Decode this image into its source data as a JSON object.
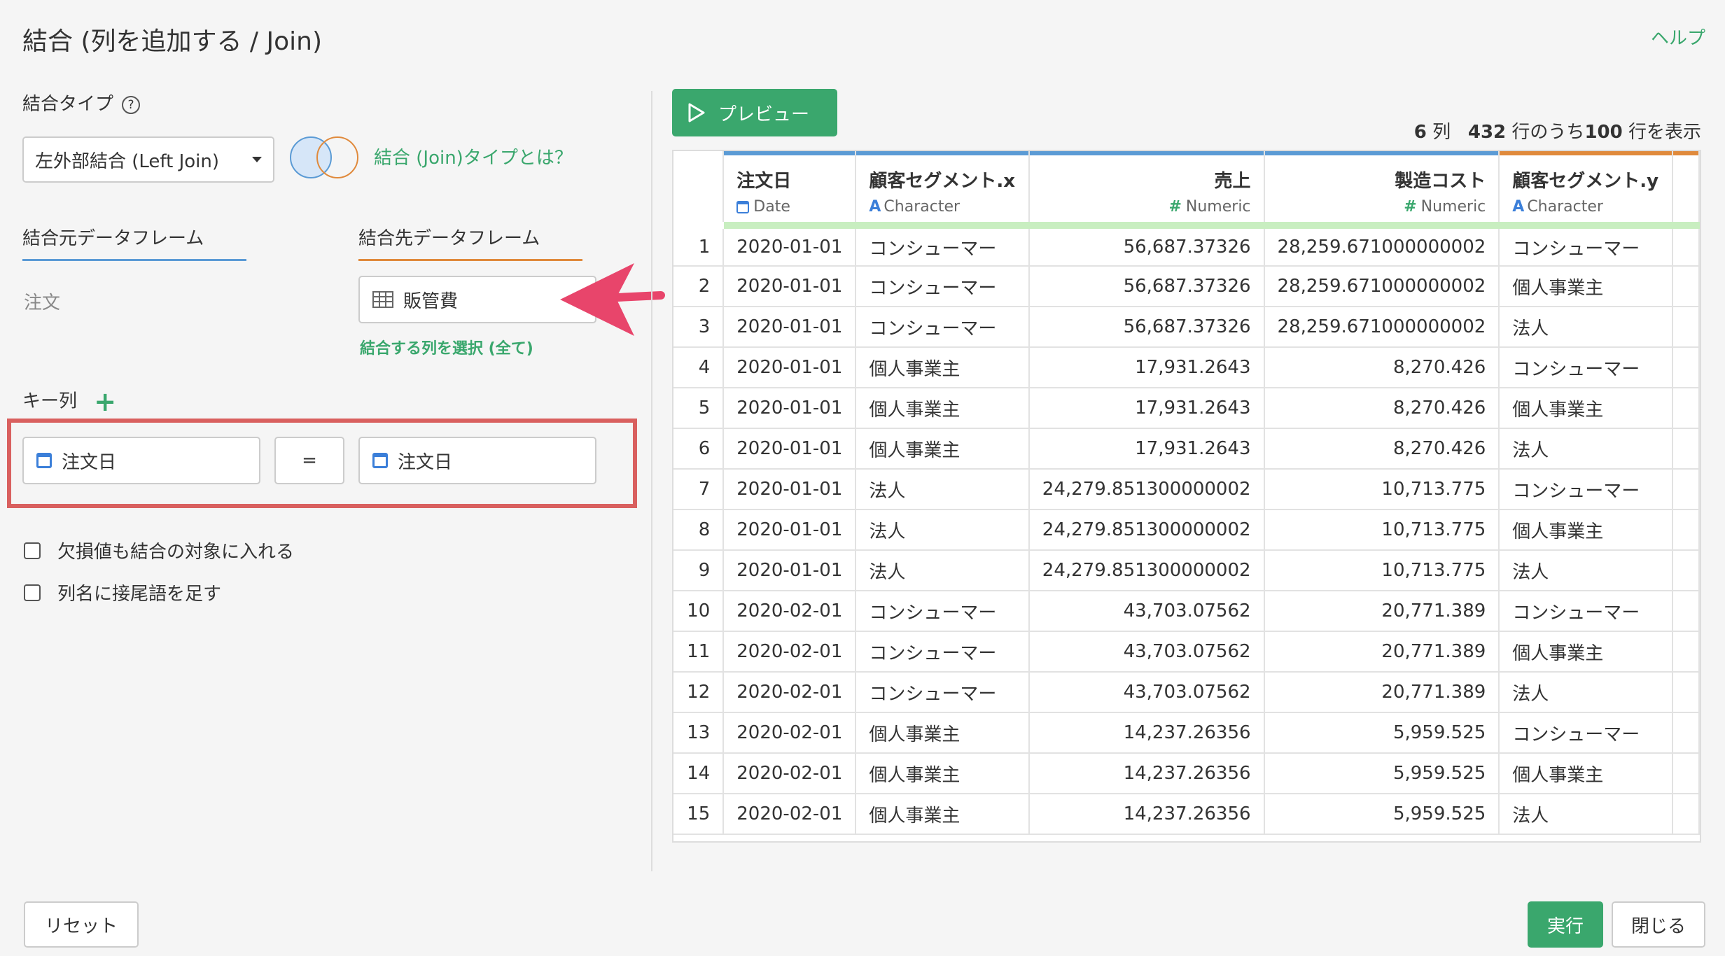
{
  "dialog": {
    "title": "結合 (列を追加する / Join)",
    "help": "ヘルプ"
  },
  "join_type": {
    "label": "結合タイプ",
    "help_mark": "?",
    "selected": "左外部結合 (Left Join)",
    "link": "結合 (Join)タイプとは？"
  },
  "source": {
    "tab_label": "結合元データフレーム",
    "value": "注文"
  },
  "target": {
    "tab_label": "結合先データフレーム",
    "value": "販管費",
    "select_columns_link": "結合する列を選択 (全て)"
  },
  "keys": {
    "label": "キー列",
    "add": "+",
    "left": "注文日",
    "operator": "=",
    "right": "注文日"
  },
  "options": {
    "include_missing": "欠損値も結合の対象に入れる",
    "add_suffix": "列名に接尾語を足す"
  },
  "preview": {
    "button": "プレビュー",
    "info": {
      "cols": "6",
      "cols_unit": "列",
      "total": "432",
      "rows_of": "行のうち",
      "shown": "100",
      "rows_shown": "行を表示"
    },
    "columns": [
      {
        "name": "注文日",
        "type": "Date"
      },
      {
        "name": "顧客セグメント.x",
        "type": "Character"
      },
      {
        "name": "売上",
        "type": "Numeric"
      },
      {
        "name": "製造コスト",
        "type": "Numeric"
      },
      {
        "name": "顧客セグメント.y",
        "type": "Character"
      }
    ],
    "rows": [
      [
        "1",
        "2020-01-01",
        "コンシューマー",
        "56,687.37326",
        "28,259.671000000002",
        "コンシューマー"
      ],
      [
        "2",
        "2020-01-01",
        "コンシューマー",
        "56,687.37326",
        "28,259.671000000002",
        "個人事業主"
      ],
      [
        "3",
        "2020-01-01",
        "コンシューマー",
        "56,687.37326",
        "28,259.671000000002",
        "法人"
      ],
      [
        "4",
        "2020-01-01",
        "個人事業主",
        "17,931.2643",
        "8,270.426",
        "コンシューマー"
      ],
      [
        "5",
        "2020-01-01",
        "個人事業主",
        "17,931.2643",
        "8,270.426",
        "個人事業主"
      ],
      [
        "6",
        "2020-01-01",
        "個人事業主",
        "17,931.2643",
        "8,270.426",
        "法人"
      ],
      [
        "7",
        "2020-01-01",
        "法人",
        "24,279.851300000002",
        "10,713.775",
        "コンシューマー"
      ],
      [
        "8",
        "2020-01-01",
        "法人",
        "24,279.851300000002",
        "10,713.775",
        "個人事業主"
      ],
      [
        "9",
        "2020-01-01",
        "法人",
        "24,279.851300000002",
        "10,713.775",
        "法人"
      ],
      [
        "10",
        "2020-02-01",
        "コンシューマー",
        "43,703.07562",
        "20,771.389",
        "コンシューマー"
      ],
      [
        "11",
        "2020-02-01",
        "コンシューマー",
        "43,703.07562",
        "20,771.389",
        "個人事業主"
      ],
      [
        "12",
        "2020-02-01",
        "コンシューマー",
        "43,703.07562",
        "20,771.389",
        "法人"
      ],
      [
        "13",
        "2020-02-01",
        "個人事業主",
        "14,237.26356",
        "5,959.525",
        "コンシューマー"
      ],
      [
        "14",
        "2020-02-01",
        "個人事業主",
        "14,237.26356",
        "5,959.525",
        "個人事業主"
      ],
      [
        "15",
        "2020-02-01",
        "個人事業主",
        "14,237.26356",
        "5,959.525",
        "法人"
      ]
    ]
  },
  "footer": {
    "reset": "リセット",
    "run": "実行",
    "close": "閉じる"
  },
  "colors": {
    "accent_green": "#3aa76d",
    "source_blue": "#5b9bd5",
    "target_orange": "#e08a3c",
    "highlight_red": "#d9605f",
    "arrow_pink": "#e8456b"
  }
}
